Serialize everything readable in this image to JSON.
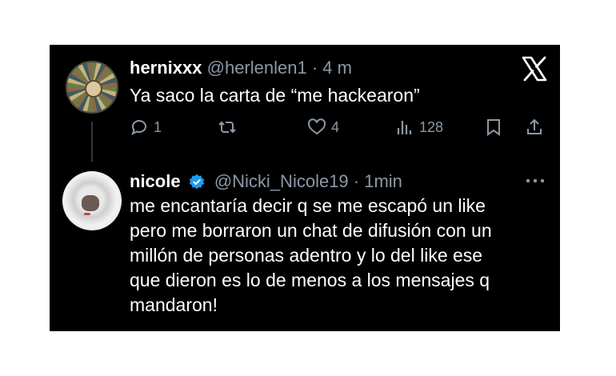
{
  "tweet1": {
    "name": "hernixxx",
    "handle": "@herlenlen1",
    "time": "· 4 m",
    "text": "Ya saco la carta de “me hackearon”",
    "replies": "1",
    "likes": "4",
    "views": "128",
    "icons": [
      "reply-icon",
      "retweet-icon",
      "like-icon",
      "views-icon",
      "bookmark-icon",
      "share-icon"
    ]
  },
  "tweet2": {
    "name": "nicole",
    "handle": "@Nicki_Nicole19",
    "time": "· 1min",
    "lines": [
      "me encantaría decir q se me escapó un like",
      "pero me borraron un chat de difusión con un",
      "millón de personas adentro y lo del like ese",
      "que dieron es lo de menos a los mensajes q",
      "mandaron!"
    ],
    "verified_color": "#1d9bf0"
  },
  "colors": {
    "background": "#000000",
    "text": "#ffffff",
    "muted": "#8b98a5"
  }
}
